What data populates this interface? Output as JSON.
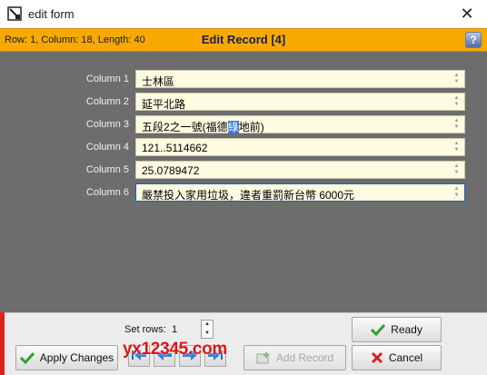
{
  "window": {
    "title": "edit form",
    "close_glyph": "✕"
  },
  "status": {
    "position_text": "Row: 1, Column: 18, Length: 40",
    "record_title": "Edit Record [4]",
    "help_glyph": "?"
  },
  "rows": [
    {
      "label": "Column 1",
      "value": "士林區"
    },
    {
      "label": "Column 2",
      "value": "延平北路"
    },
    {
      "label": "Column 3",
      "value_before": "五段2之一號(福德",
      "value_selected": "綠",
      "value_after": "地前)"
    },
    {
      "label": "Column 4",
      "value": "121..5114662"
    },
    {
      "label": "Column 5",
      "value": "25.0789472"
    },
    {
      "label": "Column 6",
      "value": "嚴禁投入家用垃圾，違者重罰新台幣 6000元"
    }
  ],
  "footer": {
    "set_rows_label": "Set rows:",
    "set_rows_value": "1",
    "apply_label": "Apply Changes",
    "add_record_label": "Add Record",
    "ready_label": "Ready",
    "cancel_label": "Cancel",
    "watermark": "yx12345.com"
  },
  "colors": {
    "status_bar": "#f7a900",
    "form_background": "#6d6d6d",
    "input_background": "#fffbe0",
    "accent_red": "#e02020",
    "selection": "#3a78d8"
  },
  "icons": [
    "app-icon",
    "close-icon",
    "help-icon",
    "check-icon",
    "cancel-icon",
    "first-record-icon",
    "previous-record-icon",
    "next-record-icon",
    "last-record-icon",
    "add-record-icon"
  ]
}
